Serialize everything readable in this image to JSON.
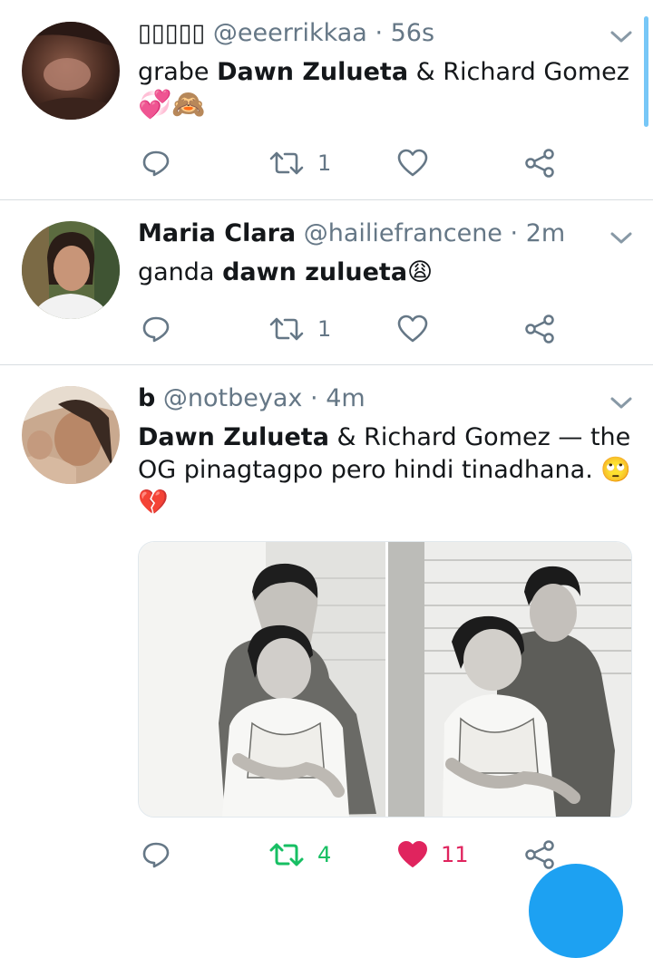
{
  "tweets": [
    {
      "name": "",
      "name_glyphs": "▯▯▯▯▯",
      "handle": "@eeerrikkaa",
      "dot": "·",
      "time": "56s",
      "text_pre": "grabe ",
      "text_bold": "Dawn Zulueta",
      "text_post": " & Richard Gomez",
      "emojis": "💞🙈",
      "actions": {
        "reply": "",
        "retweet": "1",
        "like": ""
      }
    },
    {
      "name": "Maria Clara",
      "handle": "@hailiefrancene",
      "dot": "·",
      "time": "2m",
      "text_pre": "ganda ",
      "text_bold": "dawn zulueta",
      "emoji": "😩",
      "actions": {
        "reply": "",
        "retweet": "1",
        "like": ""
      }
    },
    {
      "name": "b",
      "handle": "@notbeyax",
      "dot": "·",
      "time": "4m",
      "text_bold": "Dawn Zulueta",
      "text_line1_rest": " & Richard Gomez — the",
      "text_line2": "OG pinagtagpo pero hindi tinadhana. ",
      "emoji_eyes": "🙄",
      "emoji_heart": "💔",
      "actions": {
        "reply": "",
        "retweet": "4",
        "like": "11"
      }
    }
  ],
  "icons": {
    "reply": "reply-icon",
    "retweet": "retweet-icon",
    "like": "heart-icon",
    "share": "share-icon",
    "menu": "chevron-down-icon"
  },
  "colors": {
    "accent": "#1da1f2",
    "retweet_active": "#17bf63",
    "like_active": "#e0245e",
    "muted": "#657786"
  }
}
